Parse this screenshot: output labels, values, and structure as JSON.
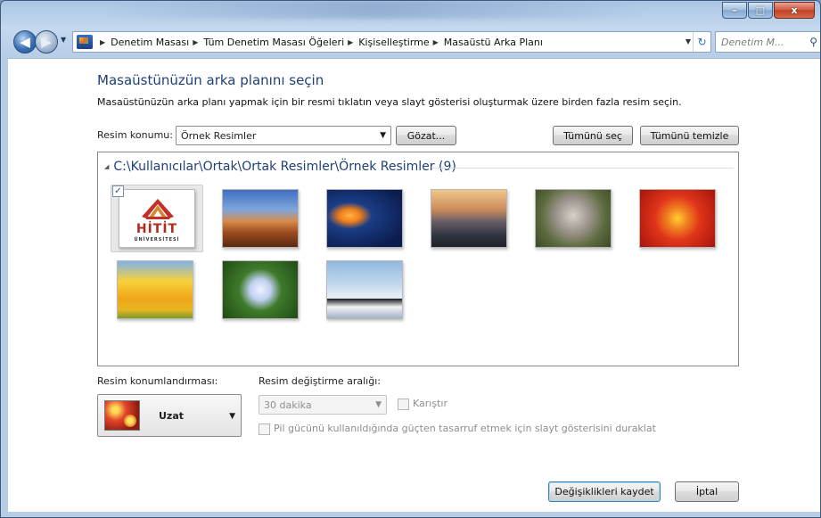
{
  "window": {
    "controls": {
      "minimize": "–",
      "maximize": "□",
      "close": "x"
    }
  },
  "navigation": {
    "back_icon": "arrow-left",
    "forward_icon": "arrow-right",
    "breadcrumbs": [
      "Denetim Masası",
      "Tüm Denetim Masası Öğeleri",
      "Kişiselleştirme",
      "Masaüstü Arka Planı"
    ],
    "search_placeholder": "Denetim M...",
    "refresh_glyph": "⁴⁄₇"
  },
  "page": {
    "title": "Masaüstünüzün arka planını seçin",
    "instructions": "Masaüstünüzün arka planı yapmak için bir resmi tıklatın veya slayt gösterisi oluşturmak üzere birden fazla resim seçin.",
    "location_label": "Resim konumu:",
    "location_value": "Örnek Resimler",
    "browse_button": "Gözat...",
    "select_all_button": "Tümünü seç",
    "clear_all_button": "Tümünü temizle"
  },
  "gallery": {
    "group_title": "C:\\Kullanıcılar\\Ortak\\Ortak Resimler\\Örnek Resimler (9)",
    "selected_check": "✓",
    "items": [
      {
        "name": "hitit-logo",
        "logo_main": "HİTİT",
        "logo_sub": "ÜNİVERSİTESİ",
        "selected": true
      },
      {
        "name": "desert"
      },
      {
        "name": "jellyfish"
      },
      {
        "name": "lighthouse"
      },
      {
        "name": "koala"
      },
      {
        "name": "chrysanthemum"
      },
      {
        "name": "tulips"
      },
      {
        "name": "hydrangeas"
      },
      {
        "name": "penguins"
      }
    ]
  },
  "position": {
    "label": "Resim konumlandırması:",
    "value": "Uzat"
  },
  "interval": {
    "label": "Resim değiştirme aralığı:",
    "value": "30 dakika",
    "shuffle_label": "Karıştır",
    "battery_label": "Pil gücünü kullanıldığında güçten tasarruf etmek için slayt gösterisini duraklat"
  },
  "footer": {
    "save_button": "Değişiklikleri kaydet",
    "cancel_button": "İptal"
  }
}
